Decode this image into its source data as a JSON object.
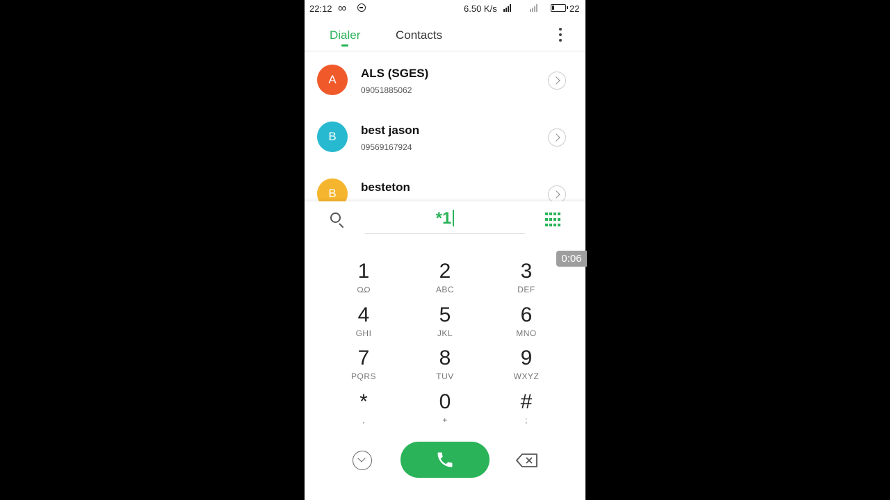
{
  "status_bar": {
    "time": "22:12",
    "network_speed": "6.50 K/s",
    "battery_level": "22",
    "icons": [
      "infinity-icon",
      "sync-icon",
      "signal-icon",
      "battery-icon"
    ]
  },
  "header": {
    "tabs": [
      {
        "label": "Dialer",
        "active": true
      },
      {
        "label": "Contacts",
        "active": false
      }
    ],
    "more_icon": "more-vertical-icon"
  },
  "contacts": [
    {
      "initial": "A",
      "name": "ALS (SGES)",
      "number": "09051885062",
      "color": "#f05a2b"
    },
    {
      "initial": "B",
      "name": "best jason",
      "number": "09569167924",
      "color": "#27b9cf"
    },
    {
      "initial": "B",
      "name": "besteton",
      "number": "",
      "color": "#f5b52e"
    }
  ],
  "dialer": {
    "input_value": "*1",
    "keys": [
      {
        "digit": "1",
        "letters": ""
      },
      {
        "digit": "2",
        "letters": "ABC"
      },
      {
        "digit": "3",
        "letters": "DEF"
      },
      {
        "digit": "4",
        "letters": "GHI"
      },
      {
        "digit": "5",
        "letters": "JKL"
      },
      {
        "digit": "6",
        "letters": "MNO"
      },
      {
        "digit": "7",
        "letters": "PQRS"
      },
      {
        "digit": "8",
        "letters": "TUV"
      },
      {
        "digit": "9",
        "letters": "WXYZ"
      },
      {
        "digit": "*",
        "letters": ","
      },
      {
        "digit": "0",
        "letters": "+"
      },
      {
        "digit": "#",
        "letters": ";"
      }
    ]
  },
  "overlay": {
    "timer": "0:06"
  },
  "colors": {
    "accent": "#2ab359",
    "background": "#000000"
  }
}
